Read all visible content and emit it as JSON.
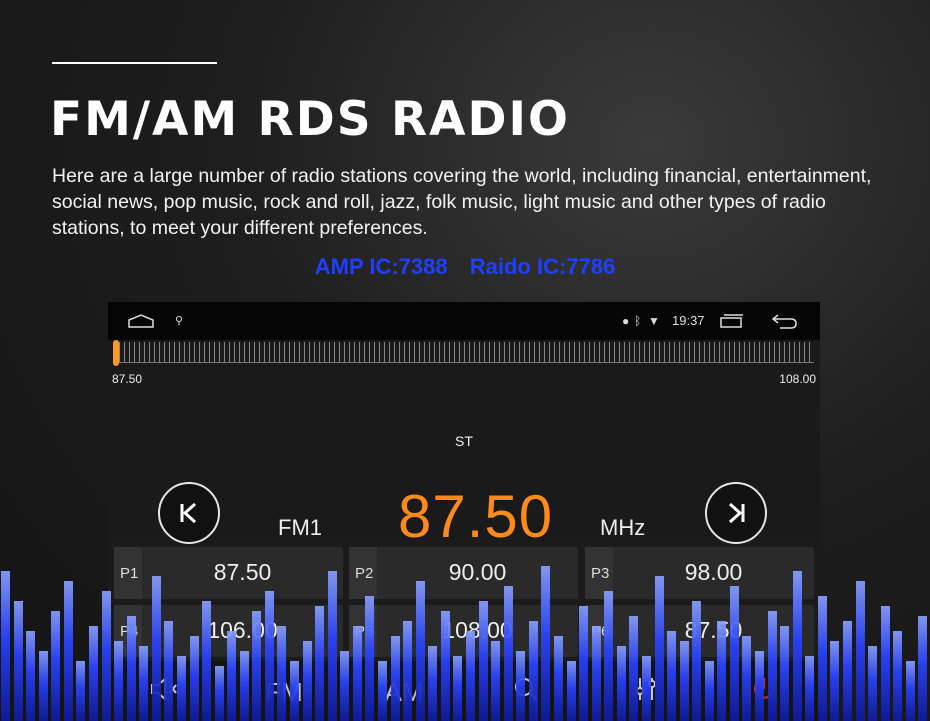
{
  "header": {
    "title": "FM/AM RDS RADIO",
    "description": "Here are a large number of radio stations covering the world, including financial, entertainment, social news, pop music, rock and roll, jazz, folk music, light music and other types of radio stations, to meet your different preferences.",
    "amp_ic": "AMP IC:7388",
    "radio_ic": "Raido IC:7786",
    "accent_color": "#1f3fff"
  },
  "statusbar": {
    "time": "19:37",
    "icons": [
      "home-icon",
      "usb-icon",
      "location-icon",
      "bluetooth-icon",
      "wifi-icon",
      "recent-apps-icon",
      "back-icon"
    ]
  },
  "tuner": {
    "scale_min": "87.50",
    "scale_max": "108.00",
    "needle_fraction": 0,
    "stereo_label": "ST",
    "band": "FM1",
    "frequency": "87.50",
    "unit": "MHz",
    "frequency_color": "#ff8a1c"
  },
  "presets": [
    {
      "label": "P1",
      "value": "87.50"
    },
    {
      "label": "P2",
      "value": "90.00"
    },
    {
      "label": "P3",
      "value": "98.00"
    },
    {
      "label": "P4",
      "value": "106.00"
    },
    {
      "label": "P5",
      "value": "108.00"
    },
    {
      "label": "P6",
      "value": "87.50"
    }
  ],
  "bottombar": {
    "mute_icon": "mute-icon",
    "fm_label": "FM",
    "am_label": "AM",
    "search_icon": "search-icon",
    "equalizer_icon": "equalizer-icon",
    "power_icon": "power-icon",
    "power_color": "#e0201a"
  }
}
